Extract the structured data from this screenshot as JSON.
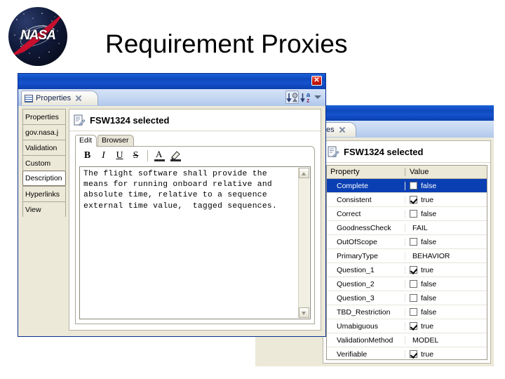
{
  "slide": {
    "title": "Requirement Proxies",
    "logo_text": "NASA",
    "logo_name": "nasa-meatball-logo"
  },
  "front_window": {
    "close_label": "✕",
    "view_tab": {
      "label": "Properties",
      "icon": "properties-table-icon"
    },
    "toolbar": [
      {
        "name": "sort-by-category-button",
        "label": "↓"
      },
      {
        "name": "sort-alphabetically-button",
        "label": "↓"
      },
      {
        "name": "view-menu-button",
        "label": ""
      }
    ],
    "az_top": "a",
    "az_bottom": "z",
    "side_tabs": [
      {
        "label": "Properties",
        "selected": false
      },
      {
        "label": "gov.nasa.j",
        "selected": false
      },
      {
        "label": "Validation",
        "selected": false
      },
      {
        "label": "Custom",
        "selected": false
      },
      {
        "label": "Description",
        "selected": true
      },
      {
        "label": "Hyperlinks",
        "selected": false
      },
      {
        "label": "View",
        "selected": false
      }
    ],
    "panel_title": "FSW1324 selected",
    "editor_tabs": [
      {
        "label": "Edit",
        "selected": true
      },
      {
        "label": "Browser",
        "selected": false
      }
    ],
    "format_buttons": [
      {
        "name": "bold-button",
        "label": "B"
      },
      {
        "name": "italic-button",
        "label": "I"
      },
      {
        "name": "underline-button",
        "label": "U"
      },
      {
        "name": "strikethrough-button",
        "label": "S"
      },
      {
        "name": "font-color-button",
        "label": "A"
      },
      {
        "name": "highlight-color-button",
        "label": "✎"
      }
    ],
    "description_text": "The flight software shall provide the means for running onboard relative and absolute time, relative to a sequence external time value,  tagged sequences."
  },
  "back_window": {
    "view_tab": {
      "label": "es",
      "icon": "properties-table-icon"
    },
    "panel_title": "FSW1324 selected",
    "table": {
      "columns": [
        "Property",
        "Value"
      ],
      "rows": [
        {
          "property": "Complete",
          "value": "false",
          "type": "checkbox",
          "checked": false,
          "selected": true
        },
        {
          "property": "Consistent",
          "value": "true",
          "type": "checkbox",
          "checked": true,
          "selected": false
        },
        {
          "property": "Correct",
          "value": "false",
          "type": "checkbox",
          "checked": false,
          "selected": false
        },
        {
          "property": "GoodnessCheck",
          "value": "FAIL",
          "type": "text",
          "checked": false,
          "selected": false
        },
        {
          "property": "OutOfScope",
          "value": "false",
          "type": "checkbox",
          "checked": false,
          "selected": false
        },
        {
          "property": "PrimaryType",
          "value": "BEHAVIOR",
          "type": "text",
          "checked": false,
          "selected": false
        },
        {
          "property": "Question_1",
          "value": "true",
          "type": "checkbox",
          "checked": true,
          "selected": false
        },
        {
          "property": "Question_2",
          "value": "false",
          "type": "checkbox",
          "checked": false,
          "selected": false
        },
        {
          "property": "Question_3",
          "value": "false",
          "type": "checkbox",
          "checked": false,
          "selected": false
        },
        {
          "property": "TBD_Restriction",
          "value": "false",
          "type": "checkbox",
          "checked": false,
          "selected": false
        },
        {
          "property": "Umabiguous",
          "value": "true",
          "type": "checkbox",
          "checked": true,
          "selected": false
        },
        {
          "property": "ValidationMethod",
          "value": "MODEL",
          "type": "text",
          "checked": false,
          "selected": false
        },
        {
          "property": "Verifiable",
          "value": "true",
          "type": "checkbox",
          "checked": true,
          "selected": false
        }
      ]
    }
  },
  "colors": {
    "title_bar_blue": "#0f49bd",
    "frame_blue": "#0a44c8",
    "selection_blue": "#0a3fb4",
    "close_red": "#cf1c10",
    "tab_beige": "#ece9d8"
  }
}
